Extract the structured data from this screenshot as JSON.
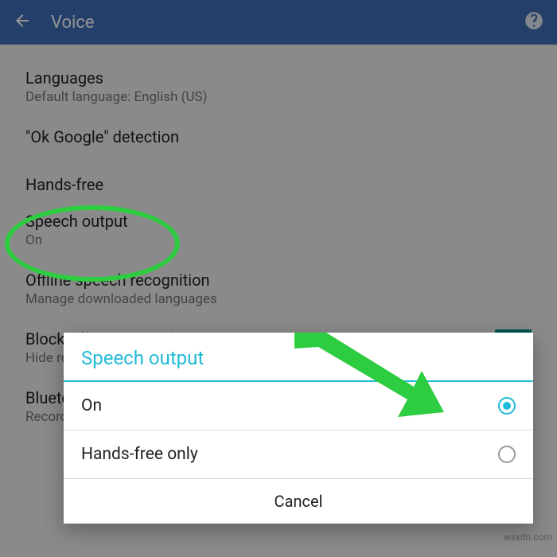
{
  "appbar": {
    "title": "Voice"
  },
  "settings": {
    "languages": {
      "title": "Languages",
      "sub": "Default language: English (US)"
    },
    "ok_google": {
      "title": "\"Ok Google\" detection"
    },
    "hands_free_header": "Hands-free",
    "speech_output": {
      "title": "Speech output",
      "sub": "On"
    },
    "offline": {
      "title": "Offline speech recognition",
      "sub": "Manage downloaded languages"
    },
    "block": {
      "title": "Block offensive words",
      "sub": "Hide recognized offensive text",
      "toggle": "ON"
    },
    "bluetooth": {
      "title": "Bluetooth headset",
      "sub": "Records audio through Bluetooth",
      "toggle": "ON"
    }
  },
  "dialog": {
    "title": "Speech output",
    "options": {
      "on": "On",
      "hands_free_only": "Hands-free only"
    },
    "cancel": "Cancel"
  },
  "watermark": "wsxdn.com"
}
